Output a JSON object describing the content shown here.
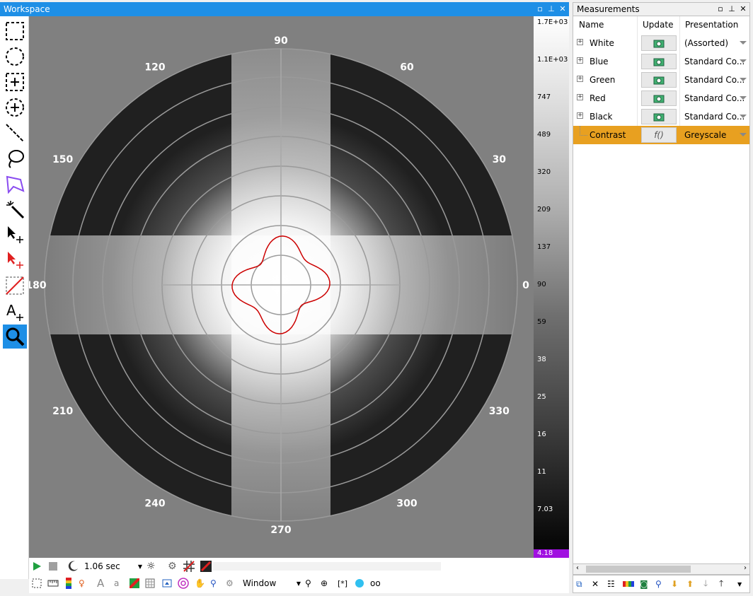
{
  "workspace": {
    "title": "Workspace"
  },
  "measurements": {
    "title": "Measurements",
    "columns": {
      "name": "Name",
      "update": "Update",
      "presentation": "Presentation"
    },
    "rows": [
      {
        "name": "White",
        "presentation": "(Assorted)",
        "expandable": true
      },
      {
        "name": "Blue",
        "presentation": "Standard  Co...",
        "expandable": true
      },
      {
        "name": "Green",
        "presentation": "Standard  Co...",
        "expandable": true
      },
      {
        "name": "Red",
        "presentation": "Standard  Co...",
        "expandable": true
      },
      {
        "name": "Black",
        "presentation": "Standard  Co...",
        "expandable": true
      },
      {
        "name": "Contrast",
        "presentation": "Greyscale",
        "expandable": false,
        "selected": true
      }
    ]
  },
  "polar": {
    "angle_labels": [
      "90",
      "60",
      "30",
      "0",
      "330",
      "300",
      "270",
      "240",
      "210",
      "180",
      "150",
      "120"
    ]
  },
  "color_scale": {
    "labels": [
      "1.7E+03",
      "1.1E+03",
      "747",
      "489",
      "320",
      "209",
      "137",
      "90",
      "59",
      "38",
      "25",
      "16",
      "11",
      "7.03"
    ],
    "min_label": "4.18"
  },
  "playback": {
    "interval": "1.06 sec"
  },
  "view": {
    "zoom_mode": "Window"
  },
  "colors": {
    "accent": "#1e8fe6",
    "selection": "#e8a020",
    "contour": "#cc0000",
    "scale_min": "#a010e0"
  }
}
